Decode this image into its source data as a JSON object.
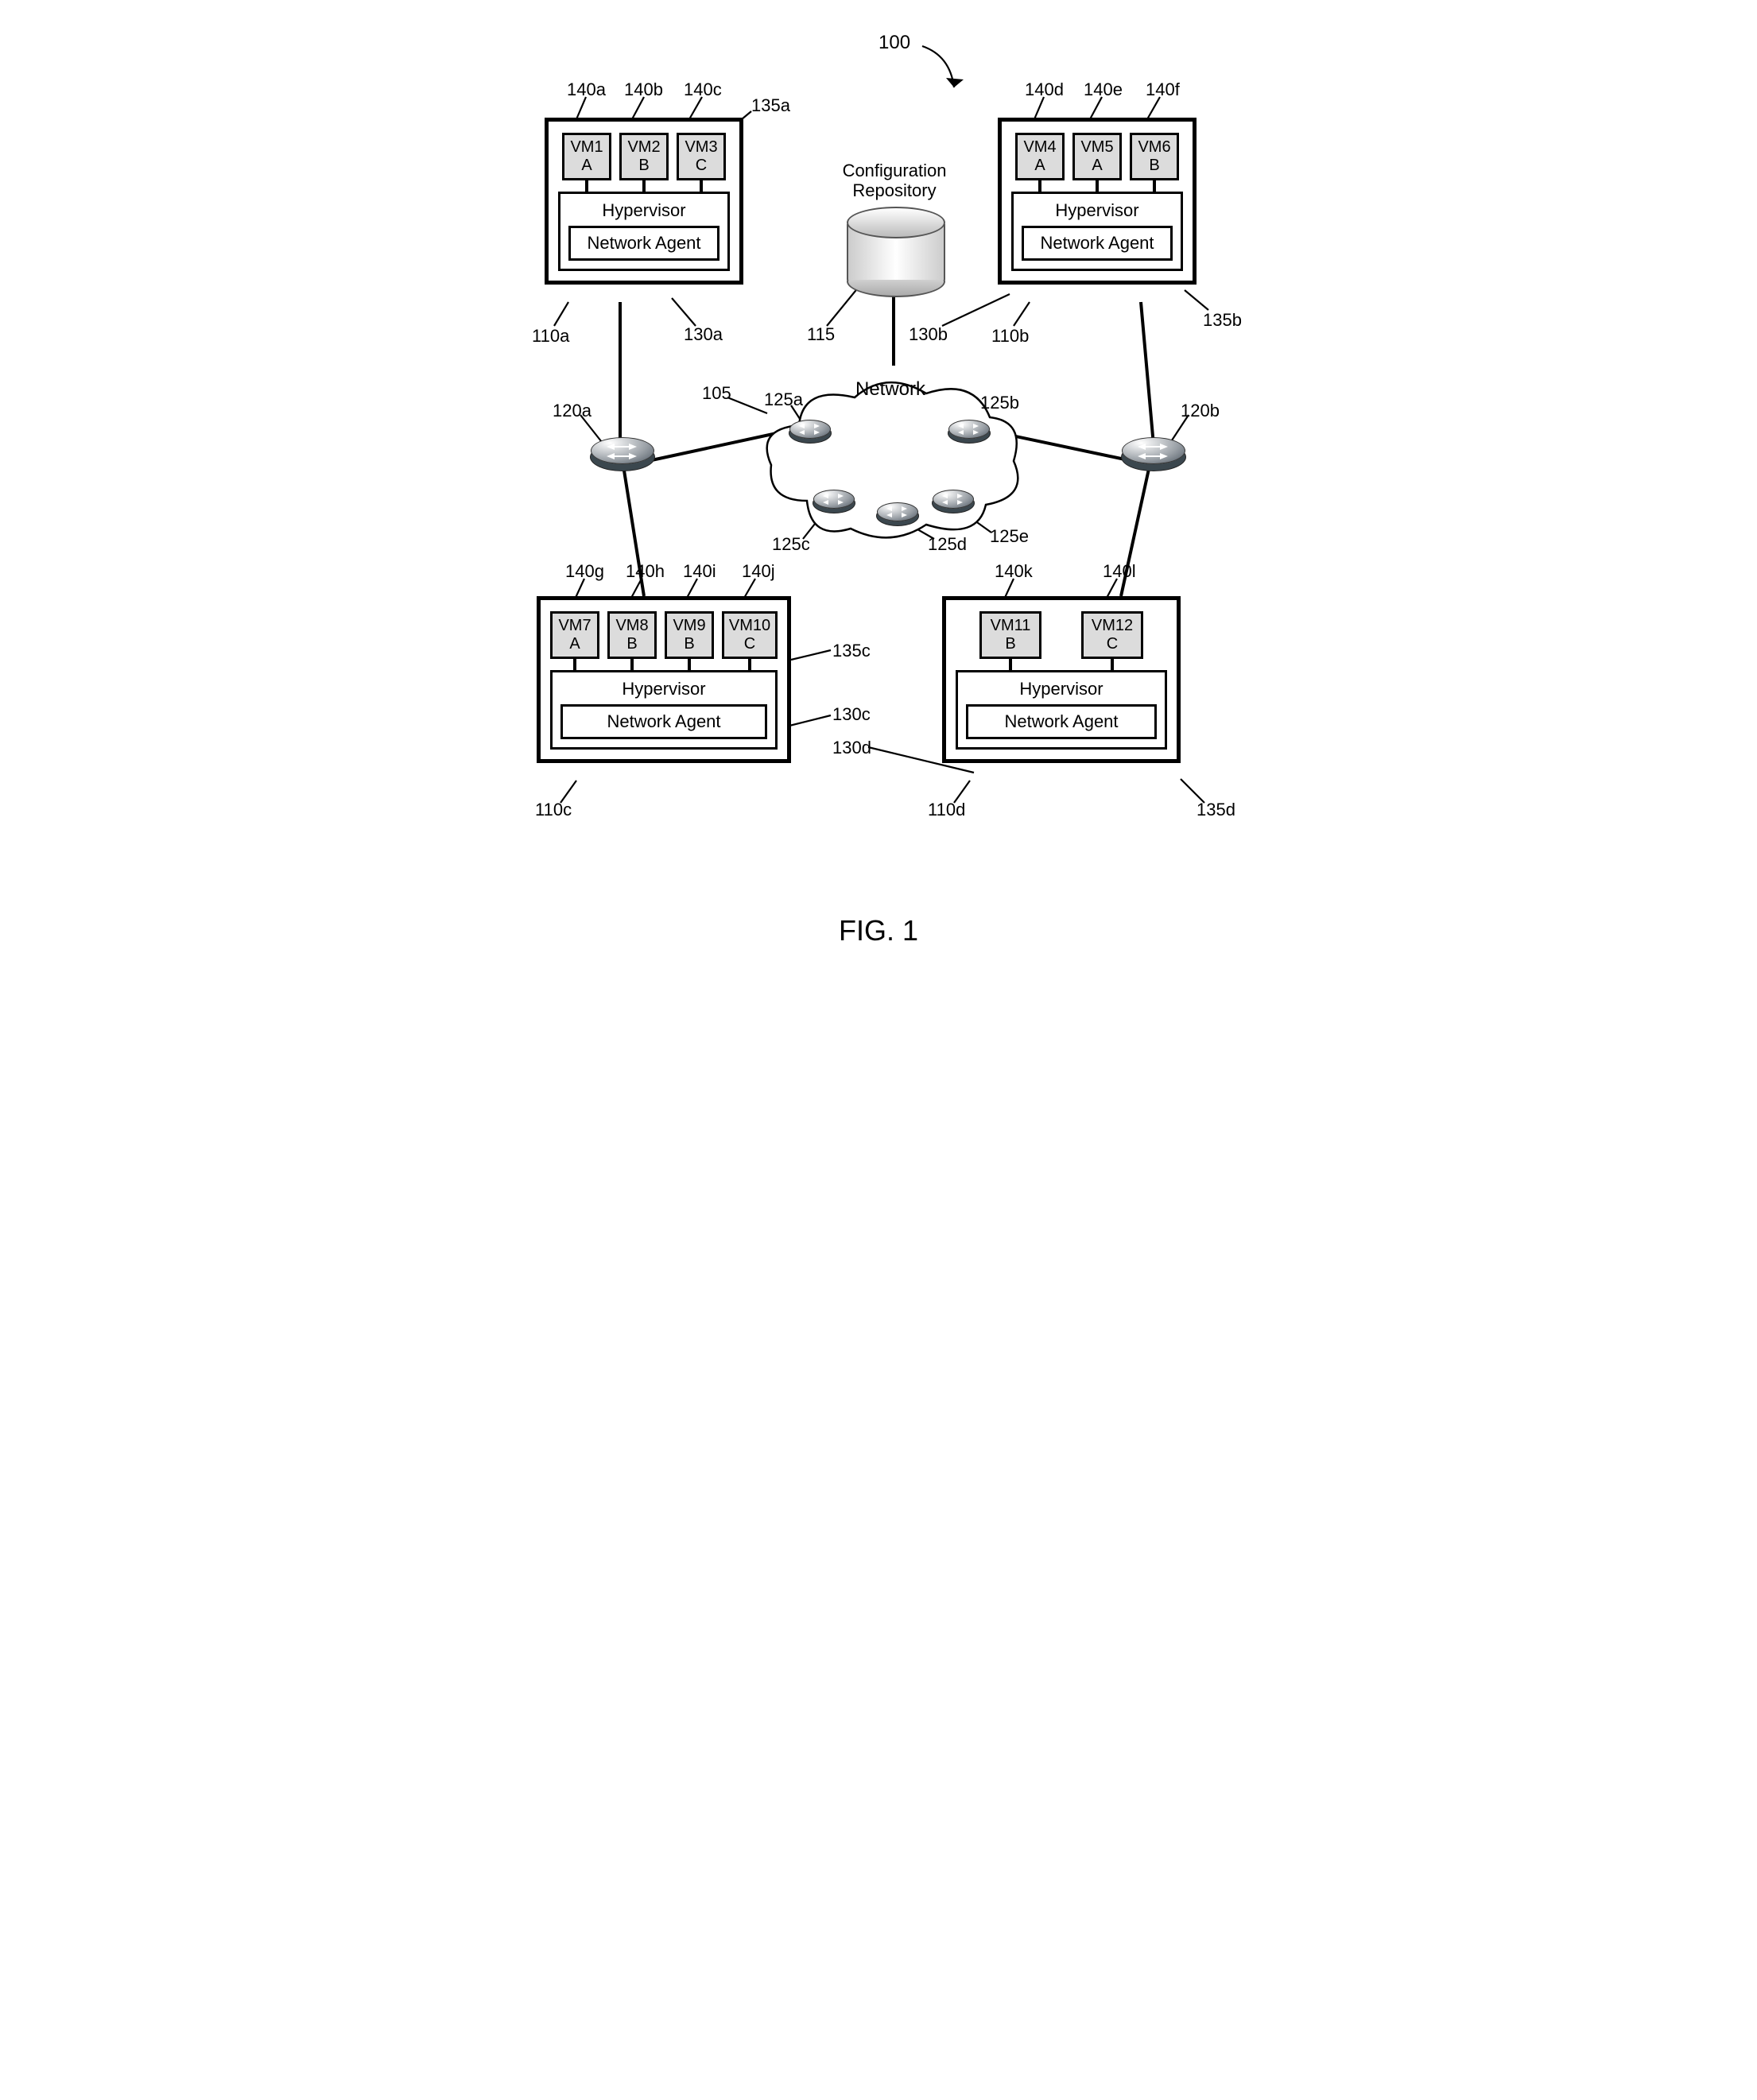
{
  "figure": {
    "caption": "FIG. 1",
    "system_ref": "100"
  },
  "repository": {
    "label": "Configuration\nRepository",
    "ref": "115"
  },
  "network": {
    "label": "Network",
    "ref": "105",
    "core_routers": [
      "125a",
      "125b",
      "125c",
      "125d",
      "125e"
    ],
    "edge_routers": [
      "120a",
      "120b"
    ]
  },
  "hosts": [
    {
      "id": "host-a",
      "host_ref": "110a",
      "hv_ref": "135a",
      "na_ref": "130a",
      "hv_label": "Hypervisor",
      "na_label": "Network Agent",
      "vms": [
        {
          "ref": "140a",
          "line1": "VM1",
          "line2": "A"
        },
        {
          "ref": "140b",
          "line1": "VM2",
          "line2": "B"
        },
        {
          "ref": "140c",
          "line1": "VM3",
          "line2": "C"
        }
      ]
    },
    {
      "id": "host-b",
      "host_ref": "110b",
      "hv_ref": "135b",
      "na_ref": "130b",
      "hv_label": "Hypervisor",
      "na_label": "Network Agent",
      "vms": [
        {
          "ref": "140d",
          "line1": "VM4",
          "line2": "A"
        },
        {
          "ref": "140e",
          "line1": "VM5",
          "line2": "A"
        },
        {
          "ref": "140f",
          "line1": "VM6",
          "line2": "B"
        }
      ]
    },
    {
      "id": "host-c",
      "host_ref": "110c",
      "hv_ref": "135c",
      "na_ref": "130c",
      "hv_label": "Hypervisor",
      "na_label": "Network Agent",
      "vms": [
        {
          "ref": "140g",
          "line1": "VM7",
          "line2": "A"
        },
        {
          "ref": "140h",
          "line1": "VM8",
          "line2": "B"
        },
        {
          "ref": "140i",
          "line1": "VM9",
          "line2": "B"
        },
        {
          "ref": "140j",
          "line1": "VM10",
          "line2": "C"
        }
      ]
    },
    {
      "id": "host-d",
      "host_ref": "110d",
      "hv_ref": "135d",
      "na_ref": "130d",
      "hv_label": "Hypervisor",
      "na_label": "Network Agent",
      "vms": [
        {
          "ref": "140k",
          "line1": "VM11",
          "line2": "B"
        },
        {
          "ref": "140l",
          "line1": "VM12",
          "line2": "C"
        }
      ]
    }
  ]
}
